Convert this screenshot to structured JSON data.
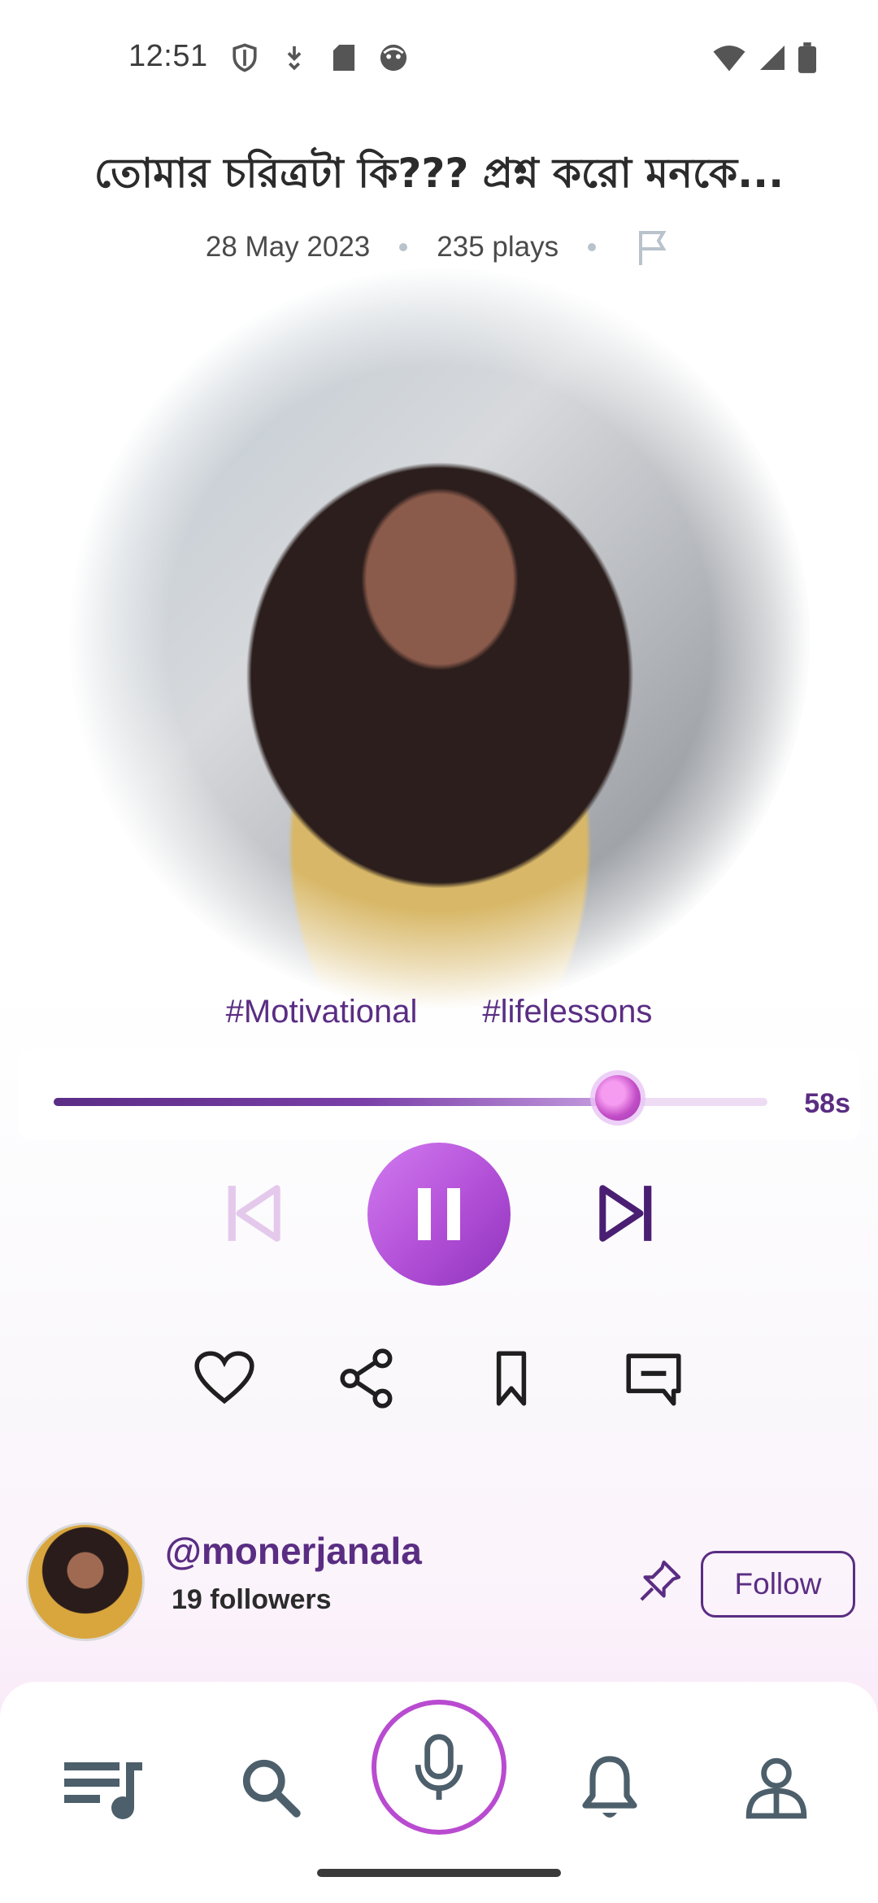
{
  "status_bar": {
    "time": "12:51"
  },
  "track": {
    "title": "তোমার  চরিত্রটা কি???  প্রশ্ন করো মনকে...",
    "date": "28 May 2023",
    "plays": "235 plays",
    "tags": [
      "#Motivational",
      "#lifelessons"
    ],
    "progress_fraction": 0.79,
    "time_label": "58s"
  },
  "creator": {
    "handle": "@monerjanala",
    "followers": "19 followers",
    "follow_label": "Follow"
  },
  "colors": {
    "accent": "#5a2d83",
    "play_button": "#b24fd7",
    "mic_ring": "#b94bd0"
  },
  "icons": {
    "status": [
      "shield-icon",
      "download-icon",
      "sd-card-icon",
      "face-icon",
      "wifi-icon",
      "signal-icon",
      "battery-icon"
    ],
    "actions": [
      "heart-icon",
      "share-icon",
      "bookmark-icon",
      "comment-icon"
    ],
    "nav": [
      "playlist-icon",
      "search-icon",
      "mic-icon",
      "bell-icon",
      "profile-icon"
    ]
  }
}
